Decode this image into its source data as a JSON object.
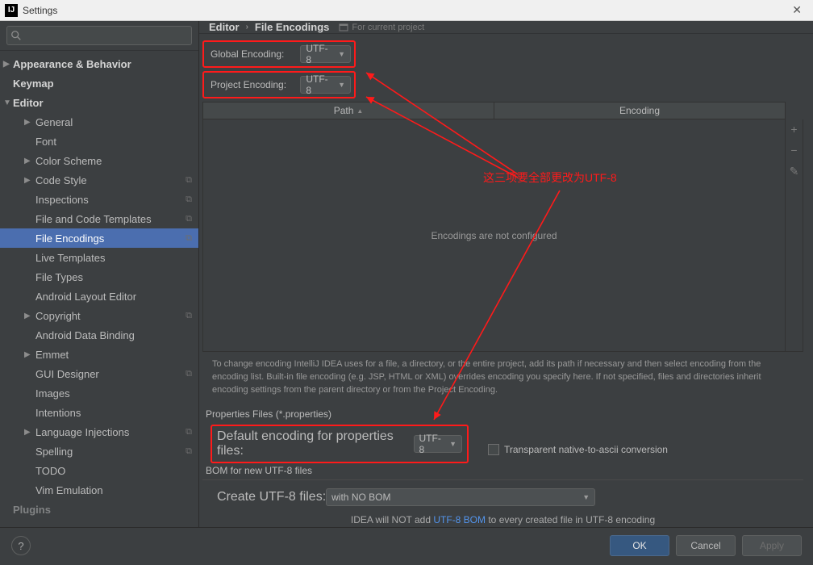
{
  "window": {
    "title": "Settings"
  },
  "search": {
    "placeholder": ""
  },
  "sidebar": {
    "items": [
      {
        "label": "Appearance & Behavior",
        "level": 1,
        "arrow": "right"
      },
      {
        "label": "Keymap",
        "level": 1
      },
      {
        "label": "Editor",
        "level": 1,
        "arrow": "down"
      },
      {
        "label": "General",
        "level": 2,
        "arrow": "right"
      },
      {
        "label": "Font",
        "level": 2
      },
      {
        "label": "Color Scheme",
        "level": 2,
        "arrow": "right"
      },
      {
        "label": "Code Style",
        "level": 2,
        "arrow": "right",
        "copy": true
      },
      {
        "label": "Inspections",
        "level": 2,
        "copy": true
      },
      {
        "label": "File and Code Templates",
        "level": 2,
        "copy": true
      },
      {
        "label": "File Encodings",
        "level": 2,
        "copy": true,
        "selected": true
      },
      {
        "label": "Live Templates",
        "level": 2
      },
      {
        "label": "File Types",
        "level": 2
      },
      {
        "label": "Android Layout Editor",
        "level": 2
      },
      {
        "label": "Copyright",
        "level": 2,
        "arrow": "right",
        "copy": true
      },
      {
        "label": "Android Data Binding",
        "level": 2
      },
      {
        "label": "Emmet",
        "level": 2,
        "arrow": "right"
      },
      {
        "label": "GUI Designer",
        "level": 2,
        "copy": true
      },
      {
        "label": "Images",
        "level": 2
      },
      {
        "label": "Intentions",
        "level": 2
      },
      {
        "label": "Language Injections",
        "level": 2,
        "arrow": "right",
        "copy": true
      },
      {
        "label": "Spelling",
        "level": 2,
        "copy": true
      },
      {
        "label": "TODO",
        "level": 2
      },
      {
        "label": "Vim Emulation",
        "level": 2
      },
      {
        "label": "Plugins",
        "level": 1,
        "faded": true
      }
    ]
  },
  "breadcrumb": {
    "a": "Editor",
    "b": "File Encodings",
    "badge": "For current project"
  },
  "global": {
    "label": "Global Encoding:",
    "value": "UTF-8"
  },
  "project": {
    "label": "Project Encoding:",
    "value": "UTF-8"
  },
  "table": {
    "col_path": "Path",
    "col_enc": "Encoding",
    "empty": "Encodings are not configured"
  },
  "help": "To change encoding IntelliJ IDEA uses for a file, a directory, or the entire project, add its path if necessary and then select encoding from the encoding list. Built-in file encoding (e.g. JSP, HTML or XML) overrides encoding you specify here. If not specified, files and directories inherit encoding settings from the parent directory or from the Project Encoding.",
  "props": {
    "section": "Properties Files (*.properties)",
    "label": "Default encoding for properties files:",
    "value": "UTF-8",
    "checkbox": "Transparent native-to-ascii conversion"
  },
  "bom": {
    "section": "BOM for new UTF-8 files",
    "label": "Create UTF-8 files:",
    "value": "with NO BOM",
    "note_pre": "IDEA will NOT add ",
    "note_link": "UTF-8 BOM",
    "note_post": " to every created file in UTF-8 encoding"
  },
  "buttons": {
    "ok": "OK",
    "cancel": "Cancel",
    "apply": "Apply"
  },
  "annotation": "这三项要全部更改为UTF-8"
}
